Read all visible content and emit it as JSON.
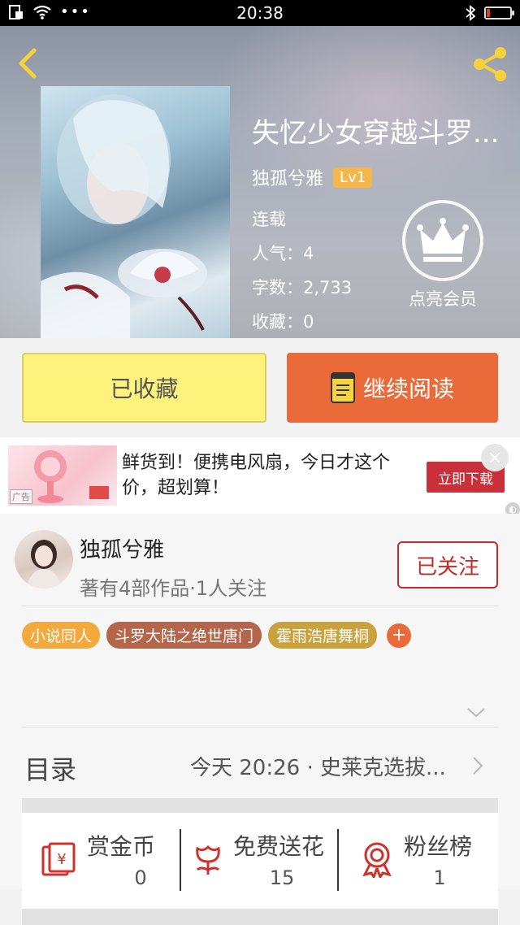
{
  "status_bar": {
    "time": "20:38"
  },
  "book": {
    "title": "失忆少女穿越斗罗...",
    "author": "独孤兮雅",
    "level": "Lv1",
    "status": "连载",
    "popularity": "人气：4",
    "word_count": "字数：2,733",
    "favorites": "收藏：0",
    "vip_label": "点亮会员"
  },
  "actions": {
    "favorite": "已收藏",
    "continue_read": "继续阅读"
  },
  "ad": {
    "text": "鲜货到！便携电风扇，今日才这个价，超划算！",
    "cta": "立即下载",
    "tag": "广告",
    "close": "×"
  },
  "author_card": {
    "name": "独孤兮雅",
    "stats": "著有4部作品·1人关注",
    "follow": "已关注",
    "tags": [
      {
        "label": "小说同人",
        "color": "#f3a93c"
      },
      {
        "label": "斗罗大陆之绝世唐门",
        "color": "#b5654a"
      },
      {
        "label": "霍雨浩唐舞桐",
        "color": "#c9a23d"
      }
    ],
    "tag_add": "+"
  },
  "toc": {
    "label": "目录",
    "latest": "今天 20:26 · 史莱克选拔..."
  },
  "stats": [
    {
      "label": "赏金币",
      "value": "0",
      "icon": "coin-envelope-icon"
    },
    {
      "label": "免费送花",
      "value": "15",
      "icon": "flower-icon"
    },
    {
      "label": "粉丝榜",
      "value": "1",
      "icon": "medal-icon"
    }
  ],
  "colors": {
    "accent": "#ea6a3a",
    "follow_red": "#c62b26",
    "fav_yellow": "#fdf37c"
  }
}
